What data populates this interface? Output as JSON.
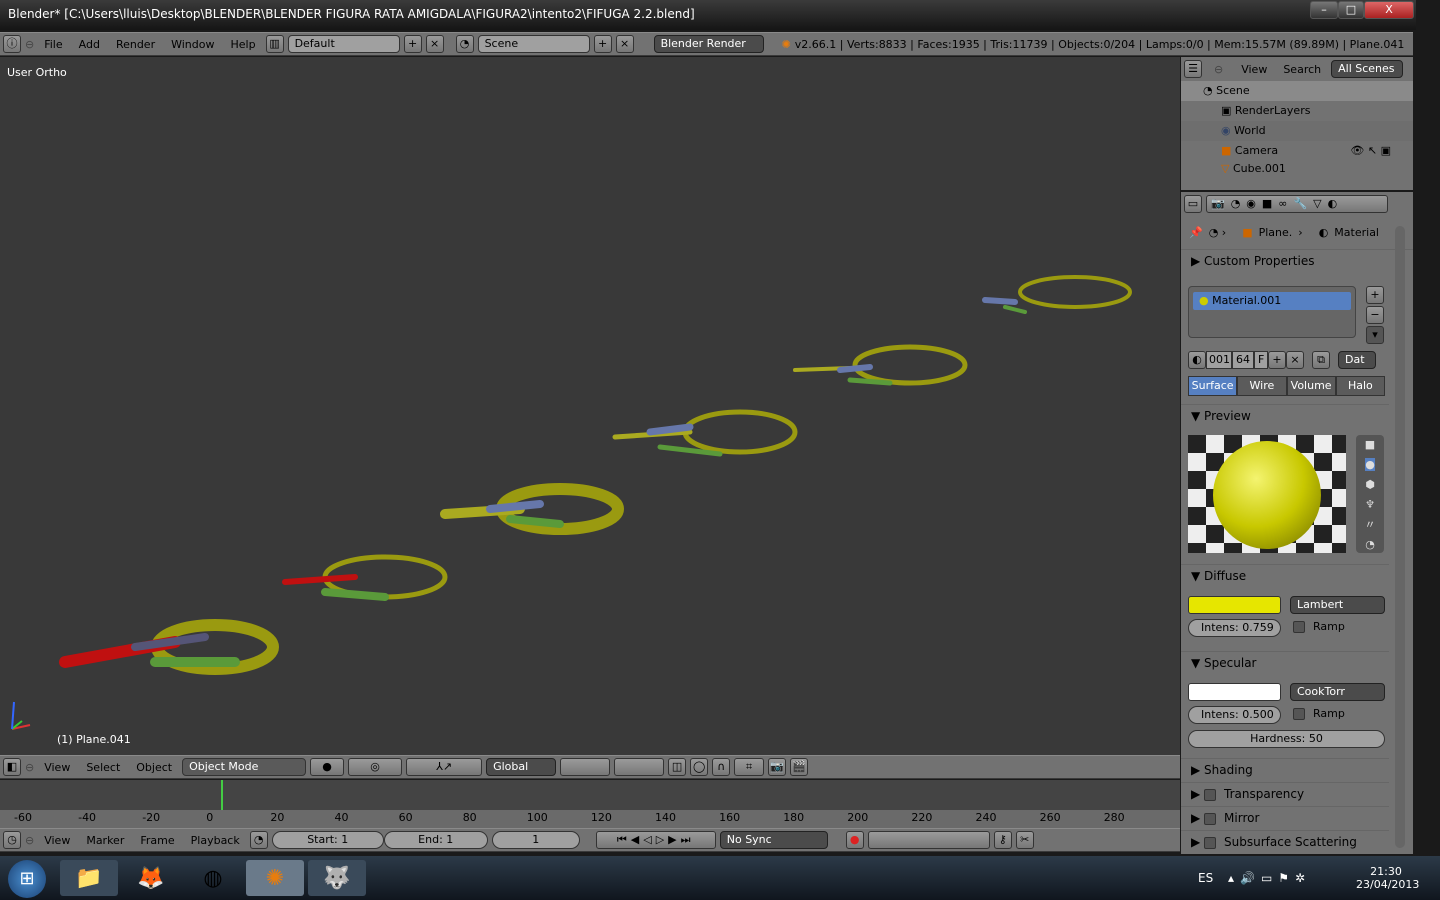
{
  "window": {
    "title": "Blender* [C:\\Users\\lluis\\Desktop\\BLENDER\\BLENDER FIGURA RATA AMIGDALA\\FIGURA2\\intento2\\FIFUGA 2.2.blend]",
    "minimize": "–",
    "maximize": "□",
    "close": "X"
  },
  "info_header": {
    "menus": [
      "File",
      "Add",
      "Render",
      "Window",
      "Help"
    ],
    "screen": "Default",
    "scene": "Scene",
    "engine": "Blender Render",
    "stats": "v2.66.1 | Verts:8833 | Faces:1935 | Tris:11739 | Objects:0/204 | Lamps:0/0 | Mem:15.57M (89.89M) | Plane.041"
  },
  "viewport": {
    "view_label": "User Ortho",
    "object_label": "(1) Plane.041",
    "axis_x": "x",
    "axis_y": "y",
    "axis_z": "z"
  },
  "view3d_header": {
    "menus": [
      "View",
      "Select",
      "Object"
    ],
    "mode": "Object Mode",
    "orientation": "Global"
  },
  "timeline": {
    "ticks": [
      "-60",
      "-40",
      "-20",
      "0",
      "20",
      "40",
      "60",
      "80",
      "100",
      "120",
      "140",
      "160",
      "180",
      "200",
      "220",
      "240",
      "260",
      "280"
    ],
    "current_frame_value": 0
  },
  "timeline_header": {
    "menus": [
      "View",
      "Marker",
      "Frame",
      "Playback"
    ],
    "start": "Start: 1",
    "end": "End: 1",
    "current": "1",
    "sync": "No Sync"
  },
  "outliner": {
    "menus": [
      "View",
      "Search"
    ],
    "filter": "All Scenes",
    "items": [
      "Scene",
      "RenderLayers",
      "World",
      "Camera",
      "Cube.001"
    ]
  },
  "properties": {
    "breadcrumb": [
      "Plane.",
      "Material"
    ],
    "custom_properties": "Custom Properties",
    "material_slot": "Material.001",
    "id_name": "001",
    "users": "64",
    "fake": "F",
    "link": "Dat",
    "tabs": [
      "Surface",
      "Wire",
      "Volume",
      "Halo"
    ],
    "active_tab": "Surface",
    "preview": "Preview",
    "diffuse": {
      "title": "Diffuse",
      "color": "#e6e600",
      "shader": "Lambert",
      "intensity": "Intens: 0.759",
      "ramp": "Ramp"
    },
    "specular": {
      "title": "Specular",
      "color": "#ffffff",
      "shader": "CookTorr",
      "intensity": "Intens: 0.500",
      "ramp": "Ramp",
      "hardness": "Hardness: 50"
    },
    "panels": [
      "Shading",
      "Transparency",
      "Mirror",
      "Subsurface Scattering"
    ]
  },
  "taskbar": {
    "lang": "ES",
    "time": "21:30",
    "date": "23/04/2013"
  }
}
